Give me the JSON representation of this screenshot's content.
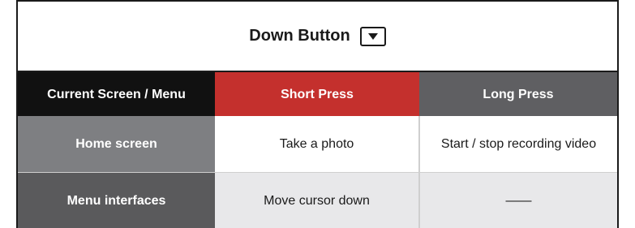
{
  "title": {
    "text": "Down Button",
    "icon": "down-arrow-key-icon"
  },
  "headers": [
    "Current Screen / Menu",
    "Short Press",
    "Long Press"
  ],
  "rows": [
    [
      "Home screen",
      "Take a photo",
      "Start / stop recording video"
    ],
    [
      "Menu interfaces",
      "Move cursor down",
      "——"
    ]
  ],
  "colors": {
    "header_current": "#111111",
    "header_short": "#c4302d",
    "header_long": "#5f5f62",
    "row1_label": "#7e7f82",
    "row2_label": "#5a5a5c",
    "row2_cells": "#e8e8ea"
  }
}
